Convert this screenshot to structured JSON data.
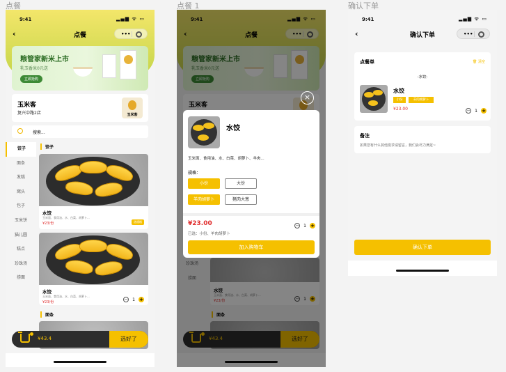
{
  "labels": {
    "frame1": "点餐",
    "frame2": "点餐 1",
    "frame3": "确认下单"
  },
  "status": {
    "time": "9:41",
    "icons": "▂▄▆ ᯤ ▭"
  },
  "nav": {
    "back": "‹",
    "title_order": "点餐",
    "title_confirm": "确认下单",
    "capsule_dots": "•••"
  },
  "banner": {
    "title": "粮管家新米上市",
    "subtitle": "乳玉香米0元送",
    "button": "立即抢购"
  },
  "shop": {
    "name": "玉米客",
    "address": "复兴中路2店",
    "logo_text": "玉米客"
  },
  "search": {
    "placeholder": "搜索..."
  },
  "sidebar": [
    "饺子",
    "面条",
    "发糕",
    "窝头",
    "包子",
    "玉米饼",
    "猫儿圆",
    "糕点",
    "珍珠汤",
    "捞面"
  ],
  "menu": {
    "category1": "饺子",
    "category2": "面条",
    "items": [
      {
        "name": "水饺",
        "desc": "玉米面、食用油、水、白菜、胡萝卜...",
        "price": "¥23",
        "unit": "/份",
        "action": "选规格"
      },
      {
        "name": "水饺",
        "desc": "玉米面、食用油、水、白菜、胡萝卜...",
        "price": "¥23",
        "unit": "/份",
        "qty": "1"
      }
    ]
  },
  "cart": {
    "amount": "¥43.4",
    "checkout": "选好了"
  },
  "modal": {
    "close": "×",
    "name": "水饺",
    "ingredients": "玉米面、食用油、水、白菜、胡萝卜、羊肉...",
    "spec_label": "规格：",
    "options": [
      {
        "label": "小份",
        "selected": true
      },
      {
        "label": "大份",
        "selected": false
      },
      {
        "label": "羊肉胡萝卜",
        "selected": true
      },
      {
        "label": "猪肉大葱",
        "selected": false
      }
    ],
    "price": "¥23.00",
    "selected_text": "已选：小份、羊肉胡萝卜",
    "qty": "1",
    "add_button": "加入购物车"
  },
  "confirm": {
    "section_title": "点餐单",
    "clear": "清空",
    "group": "-水饺-",
    "item_name": "水饺",
    "tags": [
      "小份",
      "羊肉胡萝卜"
    ],
    "price": "¥23.00",
    "qty": "1",
    "remark_title": "备注",
    "remark_placeholder": "如果您有什么其他需求请留言，我们会尽力满足~",
    "confirm_button": "确认下单"
  },
  "colors": {
    "accent": "#f5c000",
    "price": "#e02d2d",
    "dark": "#2d2d2d"
  }
}
